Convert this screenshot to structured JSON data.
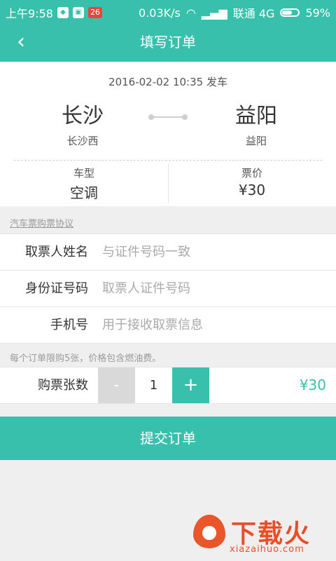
{
  "status_bar": {
    "time": "上午9:58",
    "notification_badge": "26",
    "net_speed": "0.03K/s",
    "carrier": "联通 4G",
    "battery": "59%"
  },
  "header": {
    "title": "填写订单"
  },
  "trip": {
    "departure": "2016-02-02 10:35 发车",
    "from_city": "长沙",
    "from_station": "长沙西",
    "to_city": "益阳",
    "to_station": "益阳",
    "bus_type_label": "车型",
    "bus_type_value": "空调",
    "price_label": "票价",
    "price_value": "¥30"
  },
  "agreement_link": "汽车票购票协议",
  "form": {
    "name_label": "取票人姓名",
    "name_placeholder": "与证件号码一致",
    "id_label": "身份证号码",
    "id_placeholder": "取票人证件号码",
    "phone_label": "手机号",
    "phone_placeholder": "用于接收取票信息"
  },
  "note": "每个订单限购5张，价格包含燃油费。",
  "quantity": {
    "label": "购票张数",
    "minus": "-",
    "value": "1",
    "plus": "+",
    "total": "¥30"
  },
  "submit_label": "提交订单",
  "watermark": {
    "brand": "下载火",
    "url": "xiazaihuo.com"
  },
  "colors": {
    "accent": "#38c0ac",
    "background": "#efefef",
    "watermark": "#e84f28"
  }
}
